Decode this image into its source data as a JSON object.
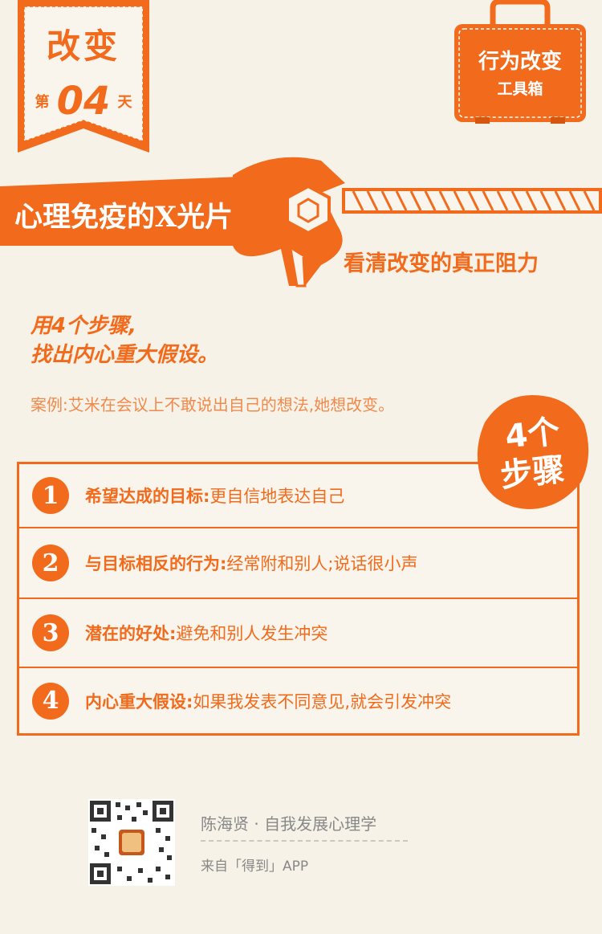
{
  "ribbon": {
    "title": "改变",
    "day_prefix": "第",
    "day_number": "04",
    "day_suffix": "天"
  },
  "toolbox": {
    "title": "行为改变",
    "subtitle": "工具箱"
  },
  "lesson": {
    "title": "心理免疫的X光片",
    "subtitle": "看清改变的真正阻力"
  },
  "intro": {
    "line1": "用4个步骤,",
    "line2": "找出内心重大假设。"
  },
  "case_text": "案例:艾米在会议上不敢说出自己的想法,她想改变。",
  "badge": {
    "top": "4个",
    "bottom": "步骤"
  },
  "steps": [
    {
      "num": "1",
      "label": "希望达成的目标:",
      "value": "更自信地表达自己"
    },
    {
      "num": "2",
      "label": "与目标相反的行为:",
      "value": "经常附和别人;说话很小声"
    },
    {
      "num": "3",
      "label": "潜在的好处:",
      "value": "避免和别人发生冲突"
    },
    {
      "num": "4",
      "label": "内心重大假设:",
      "value": "如果我发表不同意见,就会引发冲突"
    }
  ],
  "footer": {
    "author": "陈海贤 · 自我发展心理学",
    "source": "来自「得到」APP"
  },
  "colors": {
    "accent": "#f26a1b",
    "background": "#f6f2e8"
  }
}
